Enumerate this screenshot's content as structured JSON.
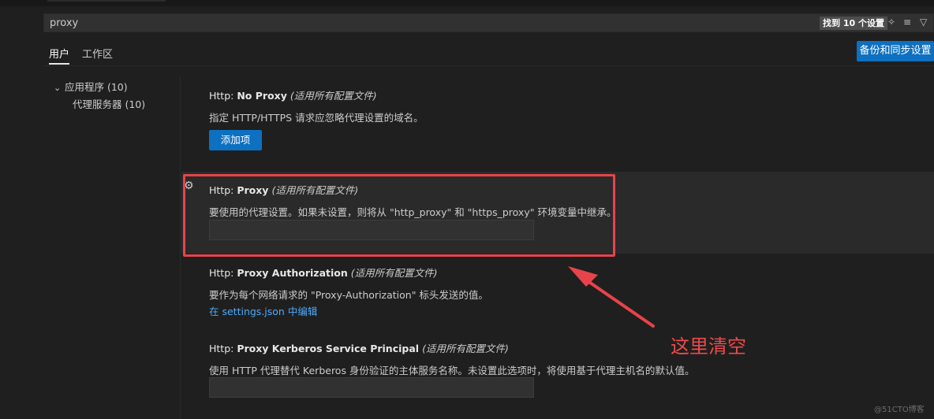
{
  "search": {
    "query": "proxy",
    "result_count": "找到 10 个设置",
    "icons": [
      "clear-filters-icon",
      "filter-list-icon",
      "filter-icon"
    ]
  },
  "tabs": [
    {
      "label": "用户",
      "active": true
    },
    {
      "label": "工作区",
      "active": false
    }
  ],
  "sync_button": "备份和同步设置",
  "toc": {
    "group": "应用程序 (10)",
    "child": "代理服务器 (10)"
  },
  "settings": [
    {
      "prefix": "Http: ",
      "name": "No Proxy",
      "scope": "(适用所有配置文件)",
      "description": "指定 HTTP/HTTPS 请求应忽略代理设置的域名。",
      "button": "添加项"
    },
    {
      "prefix": "Http: ",
      "name": "Proxy",
      "scope": "(适用所有配置文件)",
      "description": "要使用的代理设置。如果未设置，则将从 \"http_proxy\" 和 \"https_proxy\" 环境变量中继承。",
      "value": ""
    },
    {
      "prefix": "Http: ",
      "name": "Proxy Authorization",
      "scope": "(适用所有配置文件)",
      "description": "要作为每个网络请求的 \"Proxy-Authorization\" 标头发送的值。",
      "link": "在 settings.json 中编辑"
    },
    {
      "prefix": "Http: ",
      "name": "Proxy Kerberos Service Principal",
      "scope": "(适用所有配置文件)",
      "description": "使用 HTTP 代理替代 Kerberos 身份验证的主体服务名称。未设置此选项时，将使用基于代理主机名的默认值。",
      "value": ""
    }
  ],
  "annotation": "这里清空",
  "watermark": "@51CTO博客",
  "colors": {
    "background": "#1f1f1f",
    "accent_button": "#0e70c0",
    "link": "#4daafc",
    "annotation_red": "#e8434a"
  }
}
